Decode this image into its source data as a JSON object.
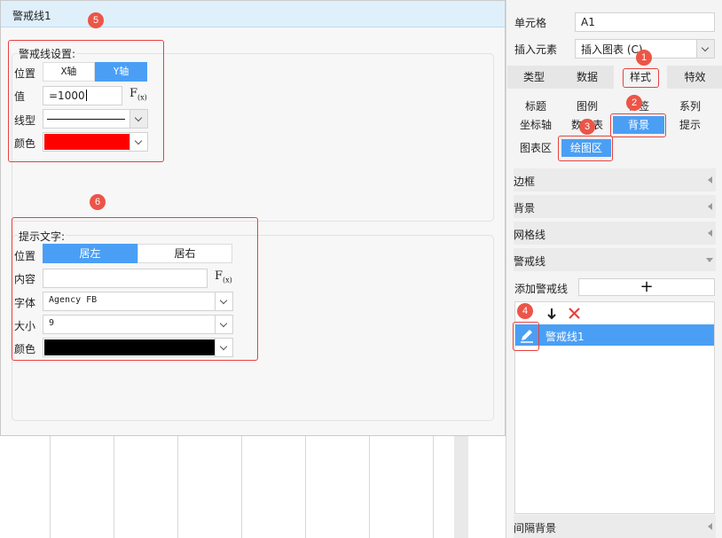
{
  "dialog": {
    "title": "警戒线1",
    "line_settings": {
      "group_label": "警戒线设置:",
      "position_label": "位置",
      "axis_x": "X轴",
      "axis_y": "Y轴",
      "value_label": "值",
      "value": "=1000",
      "fx": "F",
      "fx_sub": "(x)",
      "line_type_label": "线型",
      "color_label": "颜色",
      "line_color": "#ff0000"
    },
    "tip_text": {
      "group_label": "提示文字:",
      "position_label": "位置",
      "align_left": "居左",
      "align_right": "居右",
      "content_label": "内容",
      "content": "",
      "font_label": "字体",
      "font_value": "Agency FB",
      "size_label": "大小",
      "size_value": "9",
      "color_label": "颜色",
      "text_color": "#000000"
    }
  },
  "panel": {
    "cell_label": "单元格",
    "cell_value": "A1",
    "insert_label": "插入元素",
    "insert_value": "插入图表 (C)",
    "tabs": [
      "类型",
      "数据",
      "样式",
      "特效"
    ],
    "subtabs_row1": [
      "标题",
      "图例",
      "标签",
      "系列"
    ],
    "subtabs_row2": [
      "坐标轴",
      "数据表",
      "背景",
      "提示"
    ],
    "subtabs_row3": [
      "图表区",
      "绘图区"
    ],
    "sections": [
      "边框",
      "背景",
      "网格线",
      "警戒线"
    ],
    "add_line_label": "添加警戒线",
    "add_symbol": "+",
    "list_item": "警戒线1",
    "bottom_section": "间隔背景"
  },
  "badges": [
    "1",
    "2",
    "3",
    "4",
    "5",
    "6"
  ],
  "colors": {
    "accent": "#4a9ff5",
    "annotation": "#e8413d",
    "delete": "#e8413d"
  }
}
